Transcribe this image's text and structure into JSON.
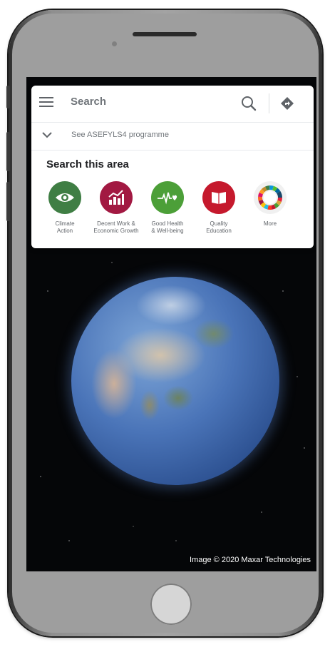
{
  "search": {
    "placeholder": "Search",
    "program_label": "See ASEFYLS4 programme"
  },
  "area": {
    "title": "Search this area",
    "categories": [
      {
        "label": "Climate\nAction",
        "color": "#3f7e44",
        "icon": "eye-icon"
      },
      {
        "label": "Decent Work &\nEconomic Growth",
        "color": "#a21942",
        "icon": "growth-chart-icon"
      },
      {
        "label": "Good Health\n& Well-being",
        "color": "#4c9f38",
        "icon": "heartbeat-icon"
      },
      {
        "label": "Quality\nEducation",
        "color": "#c5192d",
        "icon": "open-book-icon"
      },
      {
        "label": "More",
        "color": "#f0f0f0",
        "icon": "sdg-wheel-icon"
      }
    ]
  },
  "map": {
    "attribution": "Image © 2020 Maxar Technologies"
  },
  "colors": {
    "direction_icon": "#5f6368",
    "screen_background": "#050608"
  }
}
